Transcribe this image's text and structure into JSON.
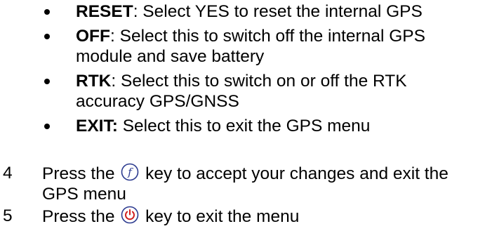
{
  "bullets": [
    {
      "term": "RESET",
      "desc": ": Select YES to reset the internal GPS"
    },
    {
      "term": "OFF",
      "desc": ": Select this to switch off the internal GPS module and save battery"
    },
    {
      "term": "RTK",
      "desc": ": Select this to switch on or off the RTK accuracy GPS/GNSS"
    },
    {
      "term": "EXIT:",
      "desc": " Select this to exit the GPS menu"
    }
  ],
  "steps": [
    {
      "number": "4",
      "prefix": "Press the",
      "icon": "function-key-icon",
      "suffix": "key to accept your changes and exit the GPS menu"
    },
    {
      "number": "5",
      "prefix": "Press the",
      "icon": "power-key-icon",
      "suffix": "key to exit the menu"
    }
  ],
  "colors": {
    "text": "#000000",
    "icon_stroke": "#2b3a8f"
  }
}
